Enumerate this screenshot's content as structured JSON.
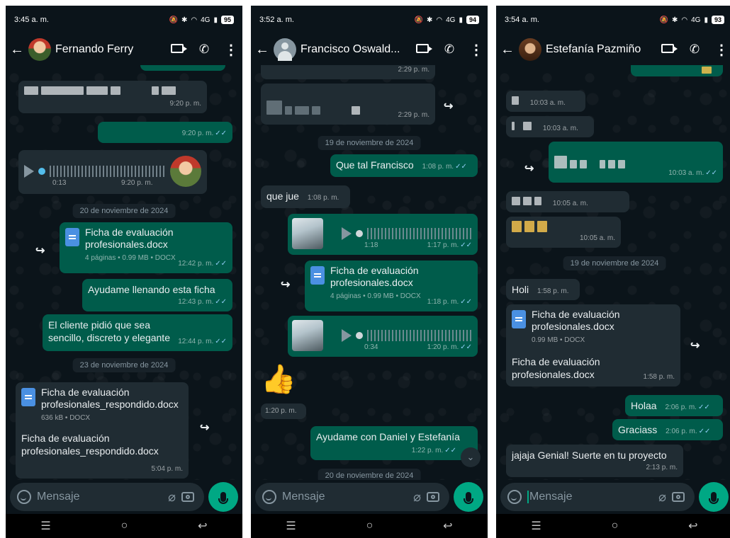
{
  "phones": [
    {
      "status": {
        "time": "3:45 a. m.",
        "signal": "4G",
        "battery": "95"
      },
      "header": {
        "contact": "Fernando Ferry"
      },
      "messages": {
        "m1_time": "9:20 p. m.",
        "m2_time": "9:20 p. m.",
        "audio_duration": "0:13",
        "audio_time": "9:20 p. m.",
        "date1": "20 de noviembre de 2024",
        "doc1_name": "Ficha de evaluación profesionales.docx",
        "doc1_meta": "4 páginas • 0.99 MB • DOCX",
        "doc1_time": "12:42 p. m.",
        "t1": "Ayudame llenando esta ficha",
        "t1_time": "12:43 p. m.",
        "t2": "El cliente pidió que sea sencillo, discreto y elegante",
        "t2_time": "12:44 p. m.",
        "date2": "23 de noviembre de 2024",
        "doc2_name": "Ficha de evaluación profesionales_respondido.docx",
        "doc2_meta": "636 kB • DOCX",
        "doc2_caption": "Ficha de evaluación profesionales_respondido.docx",
        "doc2_time": "5:04 p. m."
      },
      "input": {
        "placeholder": "Mensaje"
      }
    },
    {
      "status": {
        "time": "3:52 a. m.",
        "signal": "4G",
        "battery": "94"
      },
      "header": {
        "contact": "Francisco Oswald..."
      },
      "messages": {
        "top_time": "2:29 p. m.",
        "blur_time": "2:29 p. m.",
        "date1": "19 de noviembre de 2024",
        "t1": "Que tal Francisco",
        "t1_time": "1:08 p. m.",
        "t2": "que jue",
        "t2_time": "1:08 p. m.",
        "audio1_duration": "1:18",
        "audio1_time": "1:17 p. m.",
        "doc_name": "Ficha de evaluación profesionales.docx",
        "doc_meta": "4 páginas • 0.99 MB • DOCX",
        "doc_time": "1:18 p. m.",
        "audio2_duration": "0:34",
        "audio2_time": "1:20 p. m.",
        "sticker_time": "1:20 p. m.",
        "t3": "Ayudame con Daniel y Estefanía",
        "t3_time": "1:22 p. m.",
        "date2": "20 de noviembre de 2024"
      },
      "input": {
        "placeholder": "Mensaje"
      }
    },
    {
      "status": {
        "time": "3:54 a. m.",
        "signal": "4G",
        "battery": "93"
      },
      "header": {
        "contact": "Estefanía Pazmiño"
      },
      "messages": {
        "b1_time": "10:03 a. m.",
        "b2_time": "10:03 a. m.",
        "b3_time": "10:03 a. m.",
        "b4_time": "10:05 a. m.",
        "b5_time": "10:05 a. m.",
        "date1": "19 de noviembre de 2024",
        "t1": "Holi",
        "t1_time": "1:58 p. m.",
        "doc_name": "Ficha de evaluación profesionales.docx",
        "doc_meta": "0.99 MB • DOCX",
        "doc_caption": "Ficha de evaluación profesionales.docx",
        "doc_time": "1:58 p. m.",
        "t2": "Holaa",
        "t2_time": "2:06 p. m.",
        "t3": "Graciass",
        "t3_time": "2:06 p. m.",
        "t4": "jajaja Genial! Suerte en tu proyecto",
        "t4_time": "2:13 p. m."
      },
      "input": {
        "placeholder": "Mensaje"
      }
    }
  ],
  "colors": {
    "background": "#0b141a",
    "incoming": "#202c33",
    "outgoing": "#005c4b",
    "accent": "#00a884",
    "read_tick": "#53bdeb"
  },
  "icons": [
    "back-arrow-icon",
    "video-call-icon",
    "phone-icon",
    "more-vert-icon",
    "emoji-icon",
    "attach-icon",
    "camera-icon",
    "mic-icon",
    "forward-icon",
    "play-icon",
    "document-icon"
  ]
}
